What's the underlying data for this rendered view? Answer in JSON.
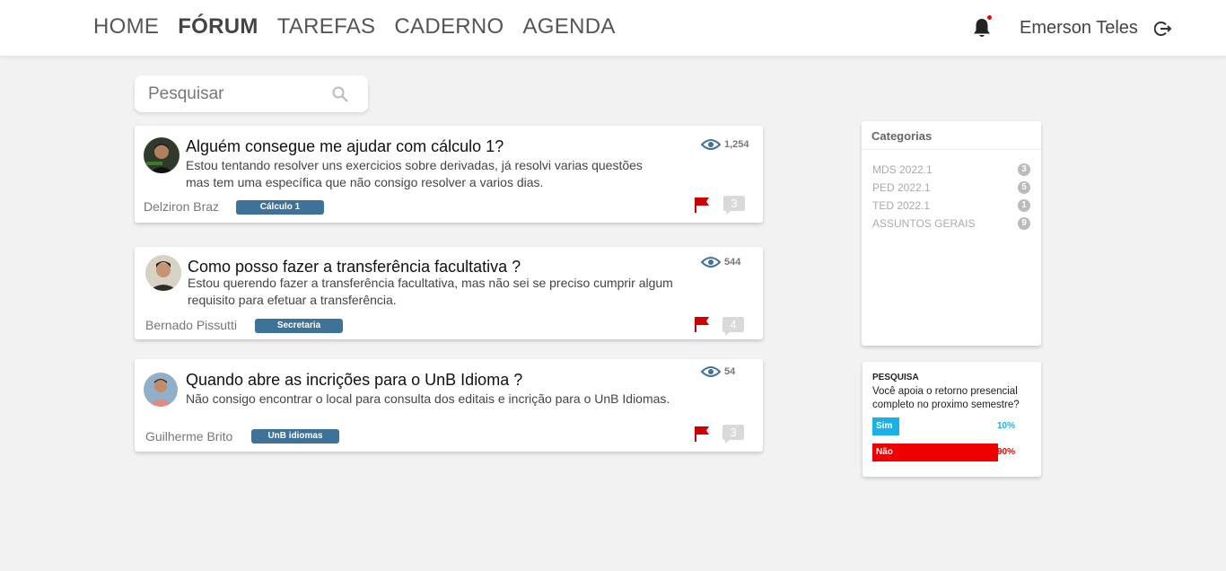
{
  "nav": {
    "items": [
      {
        "label": "HOME",
        "active": false
      },
      {
        "label": "FÓRUM",
        "active": true
      },
      {
        "label": "TAREFAS",
        "active": false
      },
      {
        "label": "CADERNO",
        "active": false
      },
      {
        "label": "AGENDA",
        "active": false
      }
    ],
    "user_name": "Emerson Teles",
    "bell_icon": "bell-icon",
    "logout_icon": "logout-icon"
  },
  "search": {
    "placeholder": "Pesquisar",
    "icon": "search-icon"
  },
  "posts": [
    {
      "title": "Alguém consegue me ajudar com cálculo 1?",
      "body": "Estou tentando resolver uns exercicios sobre derivadas, já resolvi varias questões mas tem uma específica que não consigo resolver a varios dias.",
      "author": "Delziron Braz",
      "tag": "Cálculo 1",
      "views": "1,254",
      "comments": "3"
    },
    {
      "title": "Como posso fazer a transferência facultativa ?",
      "body": "Estou querendo fazer a transferência facultativa, mas não sei se preciso cumprir algum requisito para efetuar a transferência.",
      "author": "Bernado Pissutti",
      "tag": "Secretaria",
      "views": "544",
      "comments": "4"
    },
    {
      "title": "Quando abre as incrições para o UnB Idioma ?",
      "body": "Não consigo encontrar o local para consulta dos editais e incrição para o UnB Idiomas.",
      "author": "Guilherme Brito",
      "tag": "UnB idiomas",
      "views": "54",
      "comments": "3"
    }
  ],
  "categories": {
    "title": "Categorias",
    "items": [
      {
        "label": "MDS 2022.1",
        "count": "3"
      },
      {
        "label": "PED 2022.1",
        "count": "5"
      },
      {
        "label": "TED 2022.1",
        "count": "1"
      },
      {
        "label": "ASSUNTOS GERAIS",
        "count": "9"
      }
    ]
  },
  "poll": {
    "label": "PESQUISA",
    "question": "Você apoia o retorno presencial completo no proximo semestre?",
    "options": [
      {
        "label": "Sim",
        "percent_text": "10%",
        "percent": 10,
        "color": "#1ab0e8"
      },
      {
        "label": "Não",
        "percent_text": "90%",
        "percent": 90,
        "color": "#ee0000"
      }
    ]
  },
  "colors": {
    "tag": "#3f7299",
    "views_icon": "#3f7299",
    "flag": "#cc0000",
    "bell": "#222222"
  }
}
